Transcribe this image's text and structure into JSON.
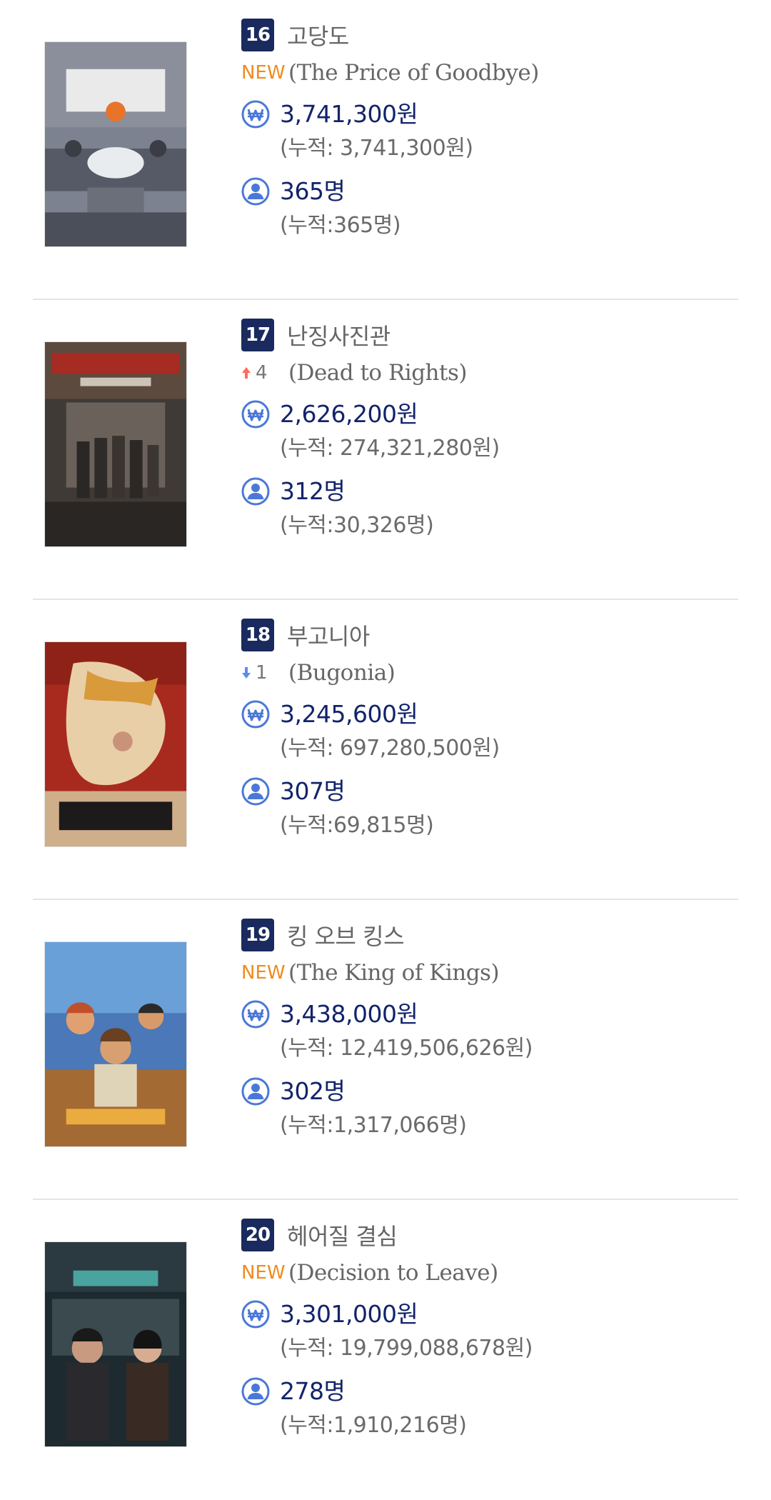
{
  "colors": {
    "rank_bg": "#1a2a5e",
    "new_badge": "#f08a1c",
    "up_arrow": "#ff6b5b",
    "down_arrow": "#5b8de8",
    "icon_blue": "#4a78d8",
    "metric_text": "#13236b",
    "secondary_text": "#6a6a6a"
  },
  "items": [
    {
      "rank": "16",
      "title_ko": "고당도",
      "status_type": "new",
      "status_label": "NEW",
      "title_en": "(The Price of Goodbye)",
      "sales": "3,741,300원",
      "sales_cumulative": "(누적: 3,741,300원)",
      "audience": "365명",
      "audience_cumulative": "(누적:365명)",
      "poster_icon": "poster-image"
    },
    {
      "rank": "17",
      "title_ko": "난징사진관",
      "status_type": "up",
      "status_label": "4",
      "title_en": "(Dead to Rights)",
      "sales": "2,626,200원",
      "sales_cumulative": "(누적: 274,321,280원)",
      "audience": "312명",
      "audience_cumulative": "(누적:30,326명)",
      "poster_icon": "poster-image"
    },
    {
      "rank": "18",
      "title_ko": "부고니아",
      "status_type": "down",
      "status_label": "1",
      "title_en": "(Bugonia)",
      "sales": "3,245,600원",
      "sales_cumulative": "(누적: 697,280,500원)",
      "audience": "307명",
      "audience_cumulative": "(누적:69,815명)",
      "poster_icon": "poster-image"
    },
    {
      "rank": "19",
      "title_ko": "킹 오브 킹스",
      "status_type": "new",
      "status_label": "NEW",
      "title_en": "(The King of Kings)",
      "sales": "3,438,000원",
      "sales_cumulative": "(누적: 12,419,506,626원)",
      "audience": "302명",
      "audience_cumulative": "(누적:1,317,066명)",
      "poster_icon": "poster-image"
    },
    {
      "rank": "20",
      "title_ko": "헤어질 결심",
      "status_type": "new",
      "status_label": "NEW",
      "title_en": "(Decision to Leave)",
      "sales": "3,301,000원",
      "sales_cumulative": "(누적: 19,799,088,678원)",
      "audience": "278명",
      "audience_cumulative": "(누적:1,910,216명)",
      "poster_icon": "poster-image"
    }
  ]
}
